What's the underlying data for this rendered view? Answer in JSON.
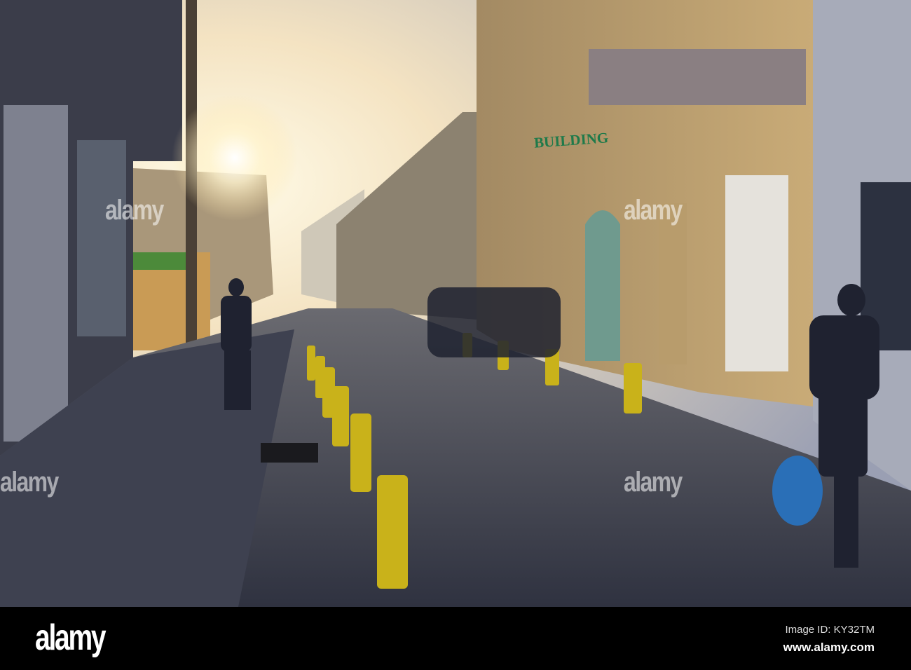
{
  "photo": {
    "building_sign": "BUILDING",
    "watermarks": [
      "alamy",
      "alamy",
      "alamy",
      "alamy"
    ]
  },
  "footer": {
    "logo": "alamy",
    "image_id": "Image ID: KY32TM",
    "url": "www.alamy.com"
  },
  "colors": {
    "sky": "#f6e9cf",
    "building_yellow": "#cfb07a",
    "street": "#3c3f4a",
    "bollard": "#c9b21a"
  }
}
